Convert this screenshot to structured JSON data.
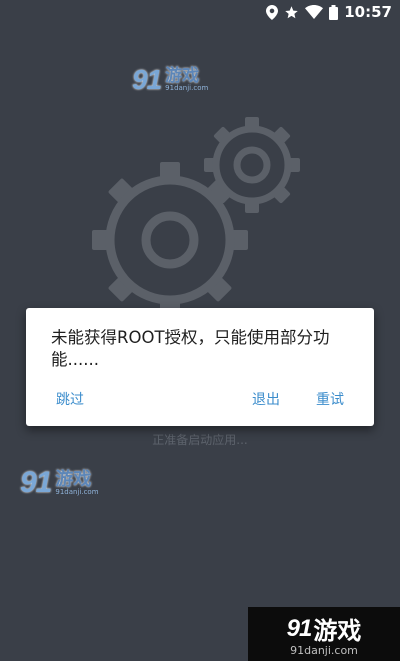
{
  "status_bar": {
    "time": "10:57",
    "icons": [
      "location-icon",
      "star-icon",
      "wifi-icon",
      "battery-icon"
    ]
  },
  "watermark": {
    "brand_number": "91",
    "brand_name": "游戏",
    "brand_domain": "91danji.com"
  },
  "loading_text": "正准备启动应用...",
  "dialog": {
    "message": "未能获得ROOT授权，只能使用部分功能......",
    "skip_label": "跳过",
    "exit_label": "退出",
    "retry_label": "重试"
  },
  "corner_logo": {
    "number": "91",
    "name": "游戏",
    "domain": "91danji.com"
  },
  "colors": {
    "background": "#3a3f48",
    "gear": "#5b6068",
    "accent_button": "#3c8dcc"
  }
}
